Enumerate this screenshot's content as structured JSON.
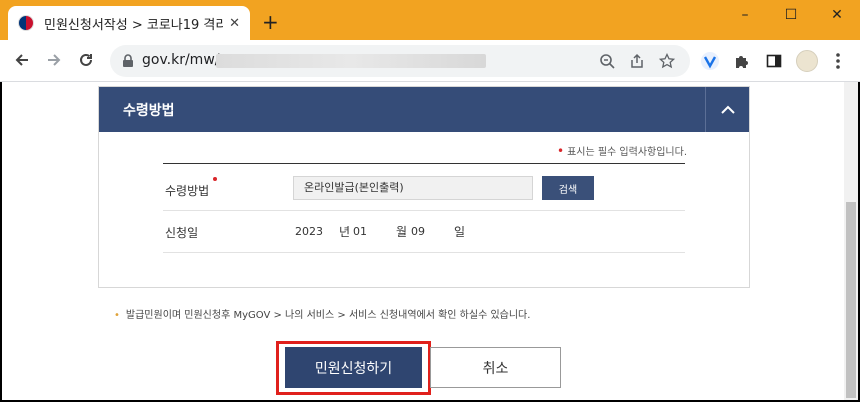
{
  "browser": {
    "tab_title": "민원신청서작성 > 코로나19 격리",
    "tab_close": "✕",
    "new_tab": "+",
    "window_controls": {
      "minimize": "–",
      "maximize": "☐",
      "close": "✕"
    },
    "url": "gov.kr/mw/",
    "colors": {
      "titlebar": "#f2a321",
      "accent": "#1a73e8"
    }
  },
  "panel": {
    "title": "수령방법",
    "required_note": "표시는 필수 입력사항입니다.",
    "rows": {
      "method_label": "수령방법",
      "method_value": "온라인발급(본인출력)",
      "search_button": "검색",
      "date_label": "신청일"
    },
    "date": {
      "year": "2023",
      "year_unit": "년",
      "month": "01",
      "month_unit": "월",
      "day": "09",
      "day_unit": "일"
    },
    "colors": {
      "header": "#354c78",
      "required": "#d9262a"
    }
  },
  "footnote": "발급민원이며 민원신청후 MyGOV > 나의 서비스 > 서비스 신청내역에서 확인 하실수 있습니다.",
  "actions": {
    "submit": "민원신청하기",
    "cancel": "취소",
    "highlight_color": "#e0201c"
  }
}
